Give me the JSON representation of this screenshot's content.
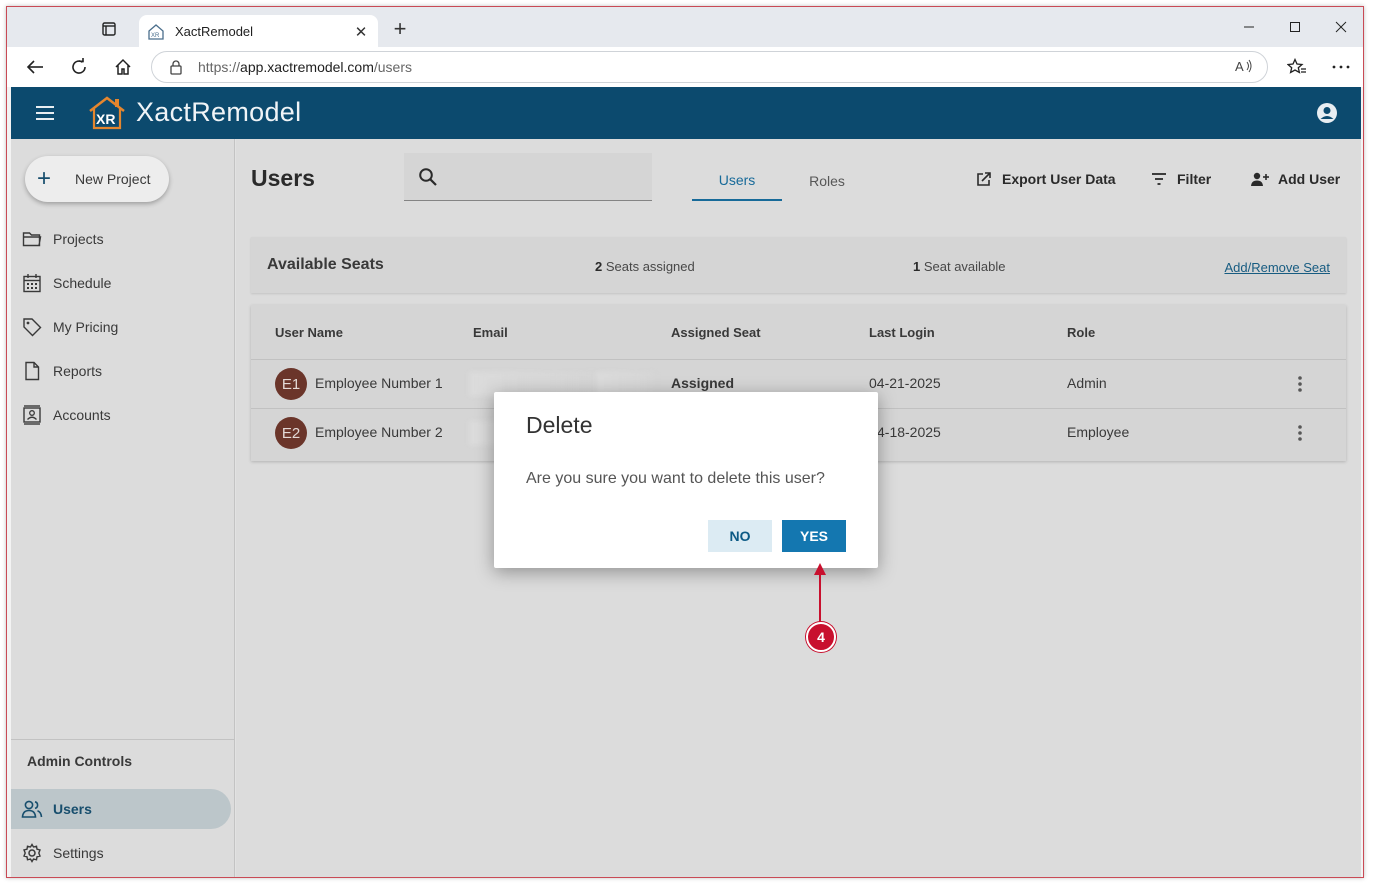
{
  "browser": {
    "tab_title": "XactRemodel",
    "url_scheme": "https://",
    "url_host": "app.xactremodel.com",
    "url_path": "/users",
    "new_tab": "+",
    "close_tab": "✕"
  },
  "app": {
    "brand": "XactRemodel",
    "logo_text": "XR",
    "accent_color": "#0c4a6e"
  },
  "sidebar": {
    "new_project_label": "New Project",
    "items": [
      {
        "label": "Projects",
        "icon": "folder-icon"
      },
      {
        "label": "Schedule",
        "icon": "calendar-icon"
      },
      {
        "label": "My Pricing",
        "icon": "tag-icon"
      },
      {
        "label": "Reports",
        "icon": "document-icon"
      },
      {
        "label": "Accounts",
        "icon": "contact-card-icon"
      }
    ],
    "admin_title": "Admin Controls",
    "admin_items": [
      {
        "label": "Users",
        "icon": "users-icon",
        "active": true
      },
      {
        "label": "Settings",
        "icon": "gear-icon",
        "active": false
      }
    ]
  },
  "main": {
    "title": "Users",
    "tabs": [
      {
        "label": "Users",
        "active": true
      },
      {
        "label": "Roles",
        "active": false
      }
    ],
    "actions": {
      "export": "Export User Data",
      "filter": "Filter",
      "add_user": "Add User"
    },
    "seats": {
      "title": "Available Seats",
      "assigned_count": "2",
      "assigned_text": " Seats assigned",
      "available_count": "1",
      "available_text": " Seat available",
      "link": "Add/Remove Seat"
    },
    "table": {
      "headers": [
        "User Name",
        "Email",
        "Assigned Seat",
        "Last Login",
        "Role"
      ],
      "rows": [
        {
          "initials": "E1",
          "name": "Employee Number 1",
          "seat": "Assigned",
          "last_login": "04-21-2025",
          "role": "Admin"
        },
        {
          "initials": "E2",
          "name": "Employee Number 2",
          "seat": "",
          "last_login": "4-18-2025",
          "role": "Employee"
        }
      ]
    }
  },
  "dialog": {
    "title": "Delete",
    "message": "Are you sure you want to delete this user?",
    "no_label": "NO",
    "yes_label": "YES"
  },
  "annotation": {
    "step": "4"
  }
}
